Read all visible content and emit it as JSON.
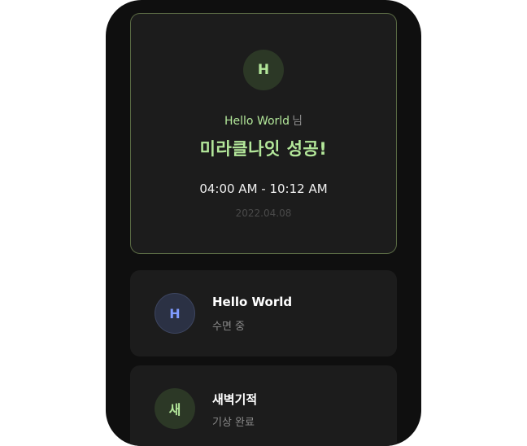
{
  "hero": {
    "avatar_initial": "H",
    "name": "Hello World",
    "name_suffix": "님",
    "title": "미라클나잇 성공!",
    "time_range": "04:00 AM - 10:12 AM",
    "date": "2022.04.08"
  },
  "friends": [
    {
      "avatar_initial": "H",
      "name": "Hello World",
      "status": "수면 중"
    },
    {
      "avatar_initial": "새",
      "name": "새벽기적",
      "status": "기상 완료"
    }
  ],
  "colors": {
    "accent_green": "#b3e79a",
    "accent_blue": "#7f9bff",
    "background": "#0f0f0f",
    "card": "#1c1c1c"
  }
}
